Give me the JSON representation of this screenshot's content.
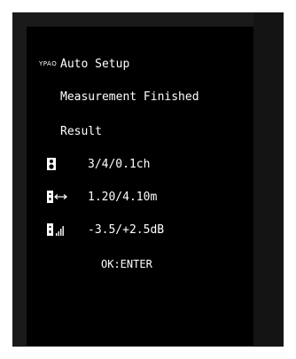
{
  "header": {
    "brand": "YPAO",
    "title": "Auto Setup"
  },
  "status": {
    "message": "Measurement Finished",
    "section": "Result"
  },
  "results": [
    {
      "icon": "speaker-icon",
      "value": "3/4/0.1ch"
    },
    {
      "icon": "speaker-distance-icon",
      "value": "1.20/4.10m"
    },
    {
      "icon": "speaker-level-icon",
      "value": "-3.5/+2.5dB"
    }
  ],
  "footer": {
    "prompt": "OK:ENTER"
  },
  "colors": {
    "background": "#000000",
    "text": "#ffffff"
  }
}
